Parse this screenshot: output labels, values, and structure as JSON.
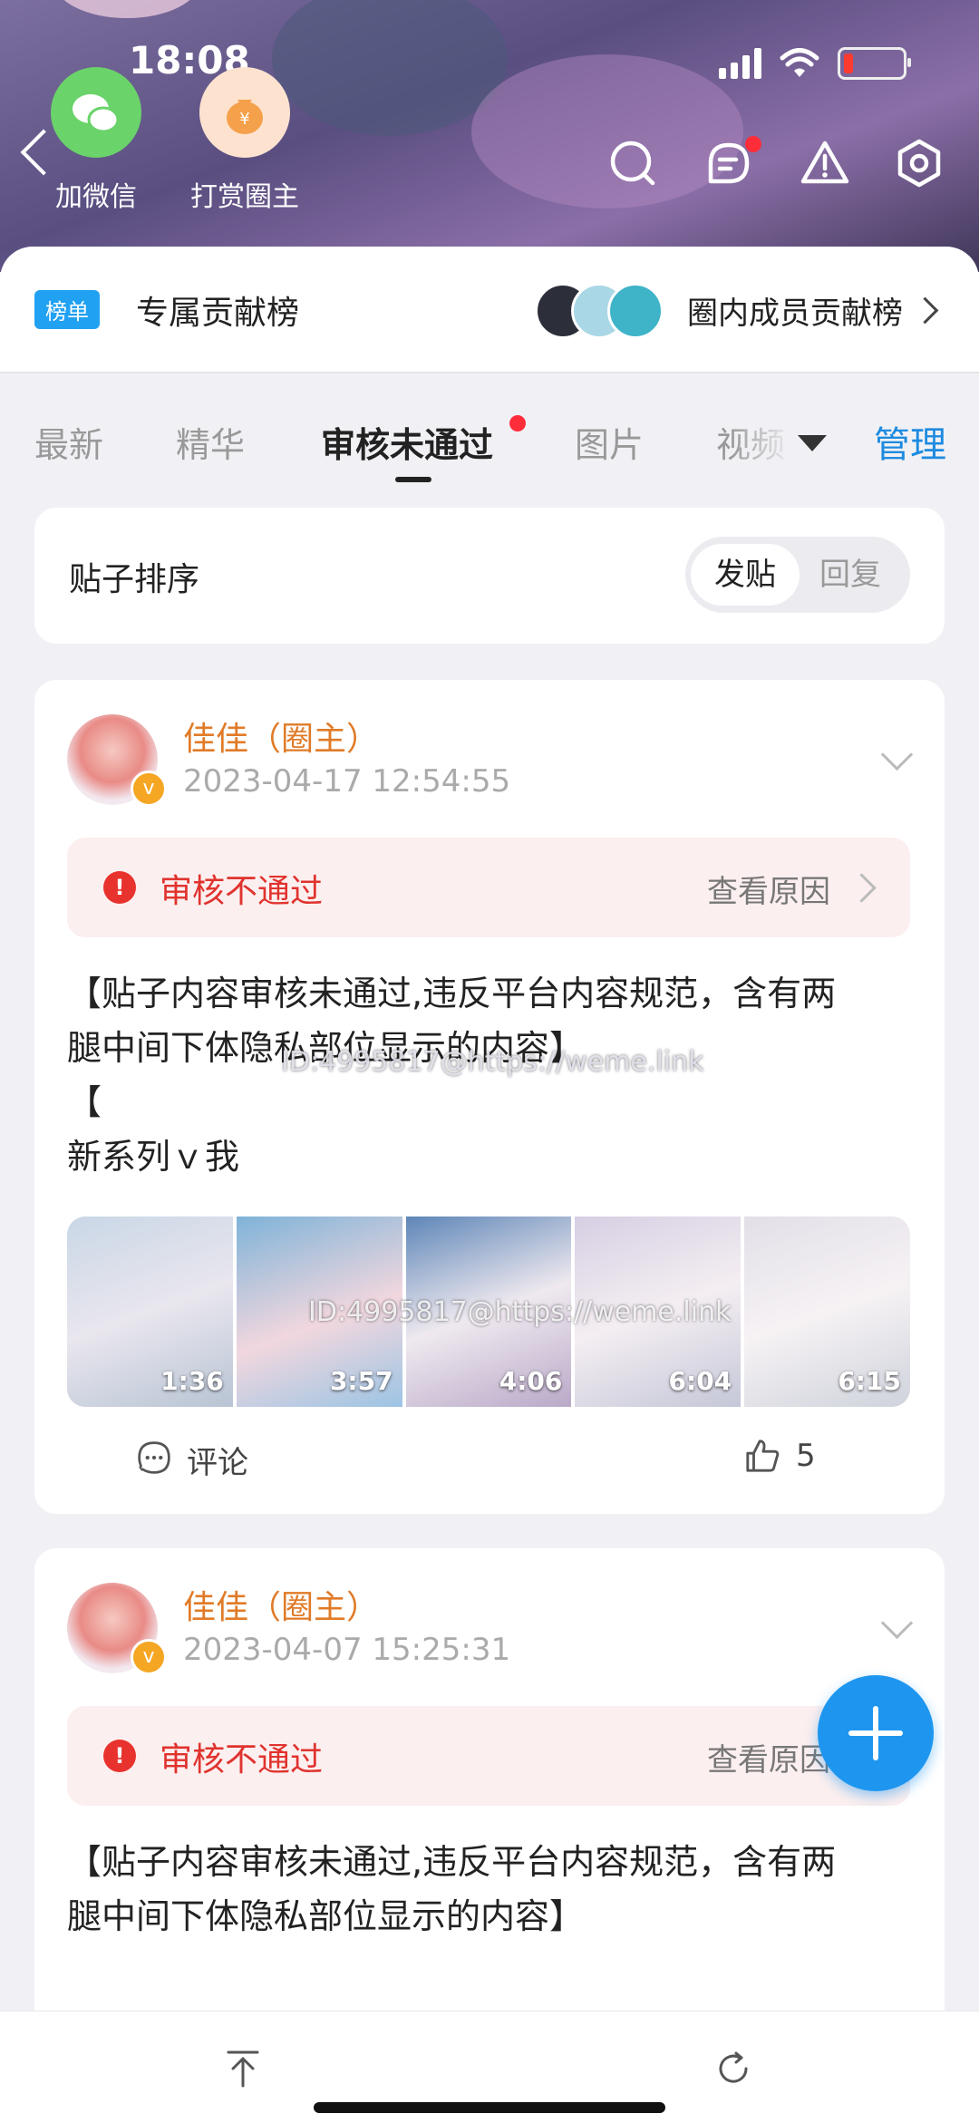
{
  "status": {
    "time": "18:08"
  },
  "header": {
    "wechat_label": "加微信",
    "tip_label": "打赏圈主",
    "icons": [
      "back-icon",
      "search-icon",
      "message-icon",
      "warning-icon",
      "settings-hex-icon"
    ]
  },
  "rank": {
    "badge": "榜单",
    "title": "专属贡献榜",
    "right_label": "圈内成员贡献榜"
  },
  "tabs": {
    "items": [
      "最新",
      "精华",
      "审核未通过",
      "图片",
      "视频"
    ],
    "active": "审核未通过",
    "manage": "管理"
  },
  "sort": {
    "label": "贴子排序",
    "options": [
      "发贴",
      "回复"
    ],
    "selected": "发贴"
  },
  "posts": [
    {
      "author": "佳佳（圈主）",
      "date": "2023-04-17 12:54:55",
      "status": "审核不通过",
      "reason_link": "查看原因",
      "text_line1": "【贴子内容审核未通过,违反平台内容规范，含有两",
      "text_line2": "腿中间下体隐私部位显示的内容】",
      "text_line3": "【",
      "text_line4": "新系列ｖ我",
      "watermark1": "ID:4995817@https://weme.link",
      "watermark2": "ID:4995817@https://weme.link",
      "durations": [
        "1:36",
        "3:57",
        "4:06",
        "6:04",
        "6:15"
      ],
      "comment_label": "评论",
      "likes": "5"
    },
    {
      "author": "佳佳（圈主）",
      "date": "2023-04-07 15:25:31",
      "status": "审核不通过",
      "reason_link": "查看原因",
      "text_line1": "【贴子内容审核未通过,违反平台内容规范，含有两",
      "text_line2": "腿中间下体隐私部位显示的内容】"
    }
  ],
  "colors": {
    "accent": "#1e8be0",
    "author": "#e07b28",
    "reject": "#e0332e"
  }
}
